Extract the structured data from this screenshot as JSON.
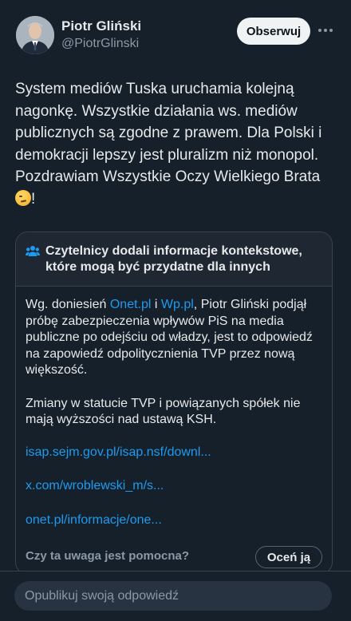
{
  "author": {
    "name": "Piotr Gliński",
    "handle": "@PiotrGlinski",
    "follow_label": "Obserwuj"
  },
  "tweet": {
    "text": "System mediów Tuska uruchamia kolejną nagonkę. Wszystkie działania ws. mediów publicznych są zgodne z prawem. Dla Polski i demokracji lepszy jest pluralizm niż monopol. Pozdrawiam Wszystkie Oczy Wielkiego Brata",
    "emoji": "winking-face",
    "suffix": "!"
  },
  "note": {
    "title": "Czytelnicy dodali informacje kontekstowe, które mogą być przydatne dla innych",
    "body_prefix": "Wg. doniesień ",
    "link1": "Onet.pl",
    "body_and": " i ",
    "link2": "Wp.pl",
    "body_rest": ", Piotr Gliński podjął próbę zabezpieczenia wpływów PiS na media publiczne po odejściu od władzy, jest to odpowiedź na zapowiedź odpolitycznienia TVP przez nową większość.",
    "paragraph2": "Zmiany w statucie TVP i powiązanych spółek nie mają wyższości nad ustawą KSH.",
    "links": [
      "isap.sejm.gov.pl/isap.nsf/downl...",
      "x.com/wroblewski_m/s...",
      "onet.pl/informacje/one..."
    ],
    "helpful_question": "Czy ta uwaga jest pomocna?",
    "rate_label": "Oceń ją"
  },
  "reply": {
    "placeholder": "Opublikuj swoją odpowiedź"
  },
  "colors": {
    "background": "#15202b",
    "link": "#1d9bf0",
    "note_header": "#1e2732"
  }
}
